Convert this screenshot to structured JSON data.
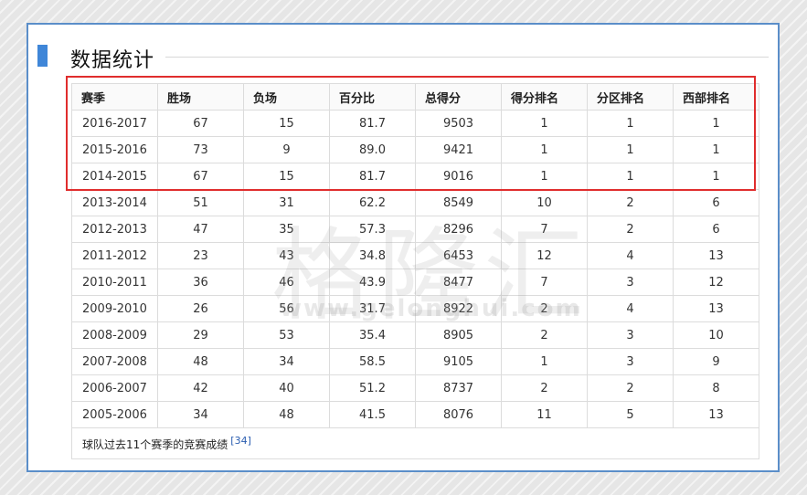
{
  "section": {
    "title": "数据统计"
  },
  "table": {
    "headers": [
      "赛季",
      "胜场",
      "负场",
      "百分比",
      "总得分",
      "得分排名",
      "分区排名",
      "西部排名"
    ],
    "rows": [
      [
        "2016-2017",
        "67",
        "15",
        "81.7",
        "9503",
        "1",
        "1",
        "1"
      ],
      [
        "2015-2016",
        "73",
        "9",
        "89.0",
        "9421",
        "1",
        "1",
        "1"
      ],
      [
        "2014-2015",
        "67",
        "15",
        "81.7",
        "9016",
        "1",
        "1",
        "1"
      ],
      [
        "2013-2014",
        "51",
        "31",
        "62.2",
        "8549",
        "10",
        "2",
        "6"
      ],
      [
        "2012-2013",
        "47",
        "35",
        "57.3",
        "8296",
        "7",
        "2",
        "6"
      ],
      [
        "2011-2012",
        "23",
        "43",
        "34.8",
        "6453",
        "12",
        "4",
        "13"
      ],
      [
        "2010-2011",
        "36",
        "46",
        "43.9",
        "8477",
        "7",
        "3",
        "12"
      ],
      [
        "2009-2010",
        "26",
        "56",
        "31.7",
        "8922",
        "2",
        "4",
        "13"
      ],
      [
        "2008-2009",
        "29",
        "53",
        "35.4",
        "8905",
        "2",
        "3",
        "10"
      ],
      [
        "2007-2008",
        "48",
        "34",
        "58.5",
        "9105",
        "1",
        "3",
        "9"
      ],
      [
        "2006-2007",
        "42",
        "40",
        "51.2",
        "8737",
        "2",
        "2",
        "8"
      ],
      [
        "2005-2006",
        "34",
        "48",
        "41.5",
        "8076",
        "11",
        "5",
        "13"
      ]
    ],
    "caption": "球队过去11个赛季的竞赛成绩",
    "reference": "[34]"
  },
  "watermark": {
    "text": "格隆汇",
    "url": "www.gelonghui.com"
  },
  "colors": {
    "accent": "#3f86d8",
    "frame": "#5b8ec9",
    "highlight": "#e02d2d"
  }
}
